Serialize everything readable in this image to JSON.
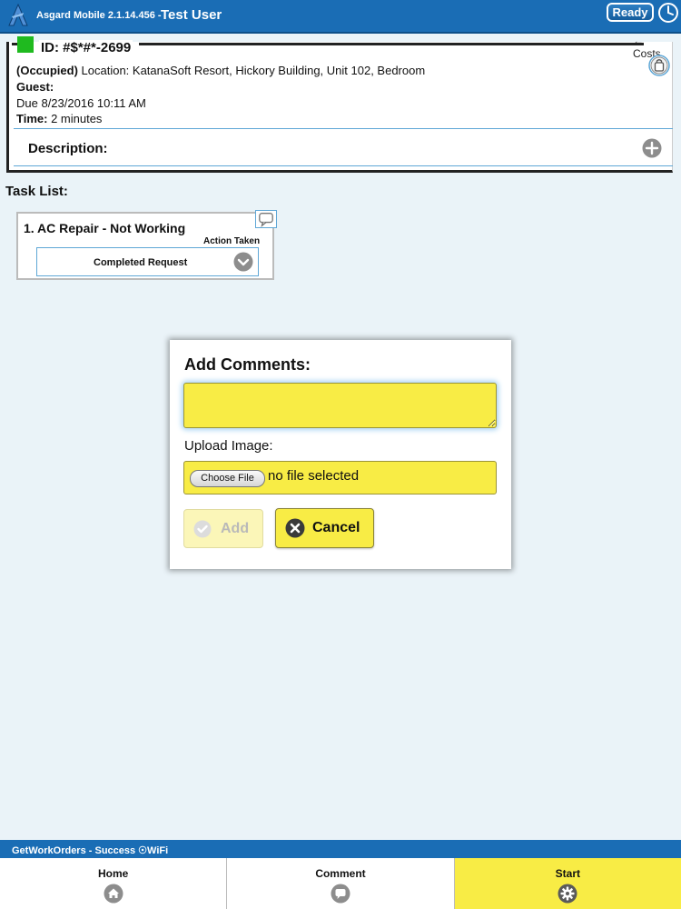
{
  "header": {
    "app_title": "Asgard Mobile 2.1.14.456 -",
    "user_name": "Test User",
    "ready_label": "Ready"
  },
  "work_order": {
    "status_color": "#1fba1f",
    "id": "ID: #$*#*-2699",
    "costs_link": "← Costs",
    "occupancy": "(Occupied)",
    "location": "Location: KatanaSoft Resort, Hickory Building, Unit 102, Bedroom",
    "guest_label": "Guest:",
    "guest_value": "",
    "due": "Due 8/23/2016 10:11 AM",
    "time_label": "Time:",
    "time_value": "2 minutes",
    "description_label": "Description:"
  },
  "task_list": {
    "heading": "Task List:",
    "tasks": [
      {
        "title": "1. AC Repair - Not Working",
        "action_label": "Action Taken",
        "action_value": "Completed Request"
      }
    ]
  },
  "dialog": {
    "title": "Add Comments:",
    "comment_value": "",
    "upload_label": "Upload Image:",
    "choose_file_label": "Choose File",
    "file_status": "no file selected",
    "add_label": "Add",
    "cancel_label": "Cancel"
  },
  "status_bar": {
    "text": "GetWorkOrders - Success ☉WiFi"
  },
  "bottom_nav": {
    "items": [
      {
        "label": "Home",
        "icon": "home-icon"
      },
      {
        "label": "Comment",
        "icon": "comment-icon"
      },
      {
        "label": "Start",
        "icon": "gear-icon",
        "active": true
      }
    ]
  },
  "colors": {
    "header_blue": "#1a6db5",
    "highlight_yellow": "#f8ec45",
    "background": "#eaf3f8"
  }
}
